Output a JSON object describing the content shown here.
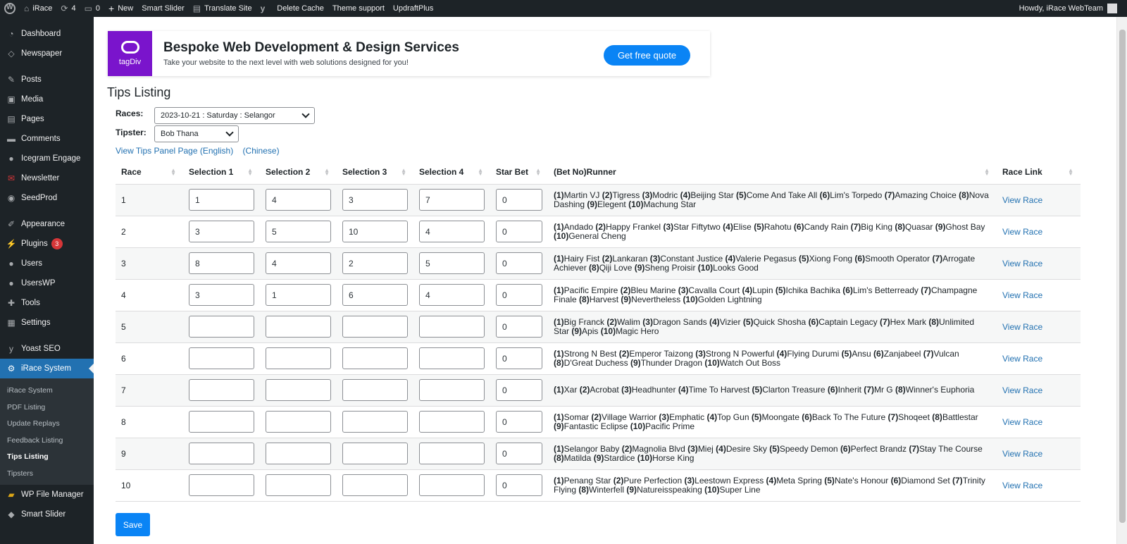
{
  "adminbar": {
    "site_name": "iRace",
    "updates_count": "4",
    "comments_count": "0",
    "new_label": "New",
    "items": [
      "Smart Slider",
      "Translate Site",
      "Delete Cache",
      "Theme support",
      "UpdraftPlus"
    ],
    "greeting": "Howdy, iRace WebTeam"
  },
  "sidebar": {
    "items": [
      {
        "label": "Dashboard",
        "icon": "dashboard-icon"
      },
      {
        "label": "Newspaper",
        "icon": "newspaper-icon"
      },
      {
        "label": "Posts",
        "icon": "pin-icon"
      },
      {
        "label": "Media",
        "icon": "media-icon"
      },
      {
        "label": "Pages",
        "icon": "pages-icon"
      },
      {
        "label": "Comments",
        "icon": "comment-icon"
      },
      {
        "label": "Icegram Engage",
        "icon": "icegram-icon"
      },
      {
        "label": "Newsletter",
        "icon": "newsletter-icon"
      },
      {
        "label": "SeedProd",
        "icon": "seedprod-icon"
      },
      {
        "label": "Appearance",
        "icon": "brush-icon"
      },
      {
        "label": "Plugins",
        "icon": "plugin-icon",
        "badge": "3"
      },
      {
        "label": "Users",
        "icon": "user-icon"
      },
      {
        "label": "UsersWP",
        "icon": "users-icon"
      },
      {
        "label": "Tools",
        "icon": "wrench-icon"
      },
      {
        "label": "Settings",
        "icon": "settings-icon"
      },
      {
        "label": "Yoast SEO",
        "icon": "yoast-icon"
      },
      {
        "label": "iRace System",
        "icon": "gear-icon"
      },
      {
        "label": "WP File Manager",
        "icon": "folder-icon"
      },
      {
        "label": "Smart Slider",
        "icon": "slider-icon"
      }
    ],
    "submenu": [
      "iRace System",
      "PDF Listing",
      "Update Replays",
      "Feedback Listing",
      "Tips Listing",
      "Tipsters"
    ]
  },
  "promo": {
    "logo_text": "tagDiv",
    "title": "Bespoke Web Development & Design Services",
    "subtitle": "Take your website to the next level with web solutions designed for you!",
    "button": "Get free quote"
  },
  "page": {
    "title": "Tips Listing",
    "races_label": "Races:",
    "races_value": "2023-10-21 : Saturday : Selangor",
    "tipster_label": "Tipster:",
    "tipster_value": "Bob Thana",
    "link_english": "View Tips Panel Page (English)",
    "link_chinese": "(Chinese)",
    "save": "Save"
  },
  "table": {
    "headers": [
      "Race",
      "Selection 1",
      "Selection 2",
      "Selection 3",
      "Selection 4",
      "Star Bet",
      "(Bet No)Runner",
      "Race Link"
    ],
    "link_text": "View Race",
    "rows": [
      {
        "race": "1",
        "s": [
          "1",
          "4",
          "3",
          "7"
        ],
        "star": "0",
        "runners": [
          "Martin VJ",
          "Tigress",
          "Modric",
          "Beijing Star",
          "Come And Take All",
          "Lim's Torpedo",
          "Amazing Choice",
          "Nova Dashing",
          "Elegent",
          "Machung Star"
        ]
      },
      {
        "race": "2",
        "s": [
          "3",
          "5",
          "10",
          "4"
        ],
        "star": "0",
        "runners": [
          "Andado",
          "Happy Frankel",
          "Star Fiftytwo",
          "Elise",
          "Rahotu",
          "Candy Rain",
          "Big King",
          "Quasar",
          "Ghost Bay",
          "General Cheng"
        ]
      },
      {
        "race": "3",
        "s": [
          "8",
          "4",
          "2",
          "5"
        ],
        "star": "0",
        "runners": [
          "Hairy Fist",
          "Lankaran",
          "Constant Justice",
          "Valerie Pegasus",
          "Xiong Fong",
          "Smooth Operator",
          "Arrogate Achiever",
          "Qiji Love",
          "Sheng Proisir",
          "Looks Good"
        ]
      },
      {
        "race": "4",
        "s": [
          "3",
          "1",
          "6",
          "4"
        ],
        "star": "0",
        "runners": [
          "Pacific Empire",
          "Bleu Marine",
          "Cavalla Court",
          "Lupin",
          "Ichika Bachika",
          "Lim's Betterready",
          "Champagne Finale",
          "Harvest",
          "Nevertheless",
          "Golden Lightning"
        ]
      },
      {
        "race": "5",
        "s": [
          "",
          "",
          "",
          ""
        ],
        "star": "0",
        "runners": [
          "Big Franck",
          "Walim",
          "Dragon Sands",
          "Vizier",
          "Quick Shosha",
          "Captain Legacy",
          "Hex Mark",
          "Unlimited Star",
          "Apis",
          "Magic Hero"
        ]
      },
      {
        "race": "6",
        "s": [
          "",
          "",
          "",
          ""
        ],
        "star": "0",
        "runners": [
          "Strong N Best",
          "Emperor Taizong",
          "Strong N Powerful",
          "Flying Durumi",
          "Ansu",
          "Zanjabeel",
          "Vulcan",
          "D'Great Duchess",
          "Thunder Dragon",
          "Watch Out Boss"
        ]
      },
      {
        "race": "7",
        "s": [
          "",
          "",
          "",
          ""
        ],
        "star": "0",
        "runners": [
          "Xar",
          "Acrobat",
          "Headhunter",
          "Time To Harvest",
          "Clarton Treasure",
          "Inherit",
          "Mr G",
          "Winner's Euphoria"
        ]
      },
      {
        "race": "8",
        "s": [
          "",
          "",
          "",
          ""
        ],
        "star": "0",
        "runners": [
          "Somar",
          "Village Warrior",
          "Emphatic",
          "Top Gun",
          "Moongate",
          "Back To The Future",
          "Shoqeet",
          "Battlestar",
          "Fantastic Eclipse",
          "Pacific Prime"
        ]
      },
      {
        "race": "9",
        "s": [
          "",
          "",
          "",
          ""
        ],
        "star": "0",
        "runners": [
          "Selangor Baby",
          "Magnolia Blvd",
          "Miej",
          "Desire Sky",
          "Speedy Demon",
          "Perfect Brandz",
          "Stay The Course",
          "Matilda",
          "Stardice",
          "Horse King"
        ]
      },
      {
        "race": "10",
        "s": [
          "",
          "",
          "",
          ""
        ],
        "star": "0",
        "runners": [
          "Penang Star",
          "Pure Perfection",
          "Leestown Express",
          "Meta Spring",
          "Nate's Honour",
          "Diamond Set",
          "Trinity Flying",
          "Winterfell",
          "Natureisspeaking",
          "Super Line"
        ]
      }
    ]
  }
}
